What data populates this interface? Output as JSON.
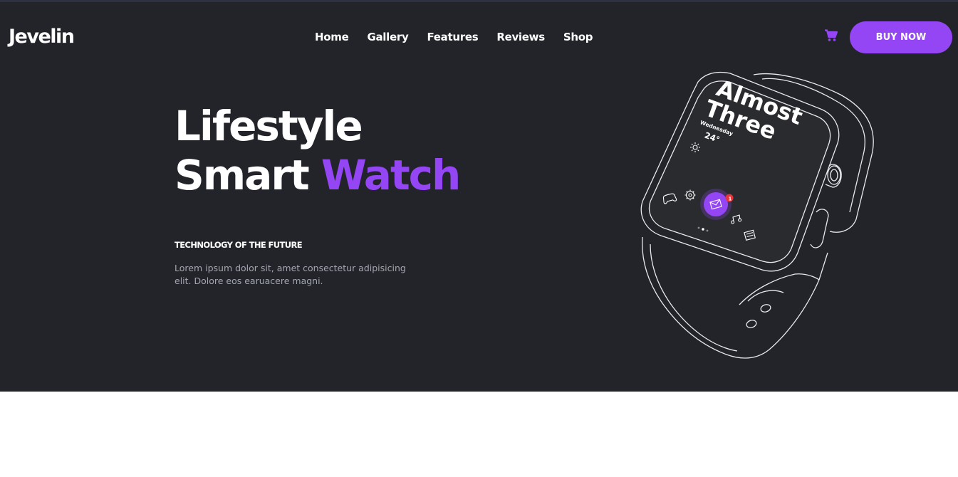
{
  "header": {
    "logo": "Jevelin",
    "nav": [
      "Home",
      "Gallery",
      "Features",
      "Reviews",
      "Shop"
    ],
    "cart_icon": "shopping-cart-icon",
    "buy_button": "BUY NOW"
  },
  "hero": {
    "headline_line1": "Lifestyle",
    "headline_line2_plain": "Smart",
    "headline_line2_accent": "Watch",
    "tagline": "TECHNOLOGY OF THE FUTURE",
    "description": "Lorem ipsum dolor sit, amet consectetur adipisicing elit. Dolore eos earuacere magni."
  },
  "watch_screen": {
    "line1": "Almost",
    "line2": "Three",
    "weather_label": "Wednesday",
    "temperature": "24°",
    "notification_count": "1"
  },
  "colors": {
    "background": "#22242a",
    "accent": "#9446f5",
    "text": "#ffffff",
    "muted": "#a3a6b0"
  }
}
